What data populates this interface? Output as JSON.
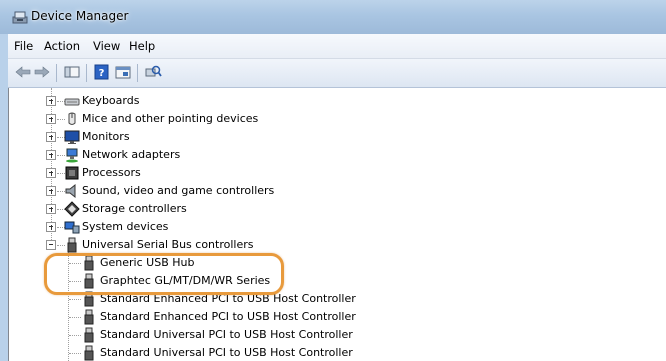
{
  "window": {
    "title": "Device Manager"
  },
  "menu": [
    "File",
    "Action",
    "View",
    "Help"
  ],
  "tree": {
    "categories": [
      {
        "label": "Keyboards",
        "icon": "keyboard-icon"
      },
      {
        "label": "Mice and other pointing devices",
        "icon": "mouse-icon"
      },
      {
        "label": "Monitors",
        "icon": "monitor-icon"
      },
      {
        "label": "Network adapters",
        "icon": "network-icon"
      },
      {
        "label": "Processors",
        "icon": "processor-icon"
      },
      {
        "label": "Sound, video and game controllers",
        "icon": "speaker-icon"
      },
      {
        "label": "Storage controllers",
        "icon": "storage-icon"
      },
      {
        "label": "System devices",
        "icon": "system-icon"
      },
      {
        "label": "Universal Serial Bus controllers",
        "icon": "usb-icon",
        "expanded": true
      }
    ],
    "usb_children": [
      "Generic USB Hub",
      "Graphtec GL/MT/DM/WR Series",
      "Standard Enhanced PCI to USB Host Controller",
      "Standard Enhanced PCI to USB Host Controller",
      "Standard Universal PCI to USB Host Controller",
      "Standard Universal PCI to USB Host Controller"
    ]
  },
  "highlight_color": "#e89a3c"
}
